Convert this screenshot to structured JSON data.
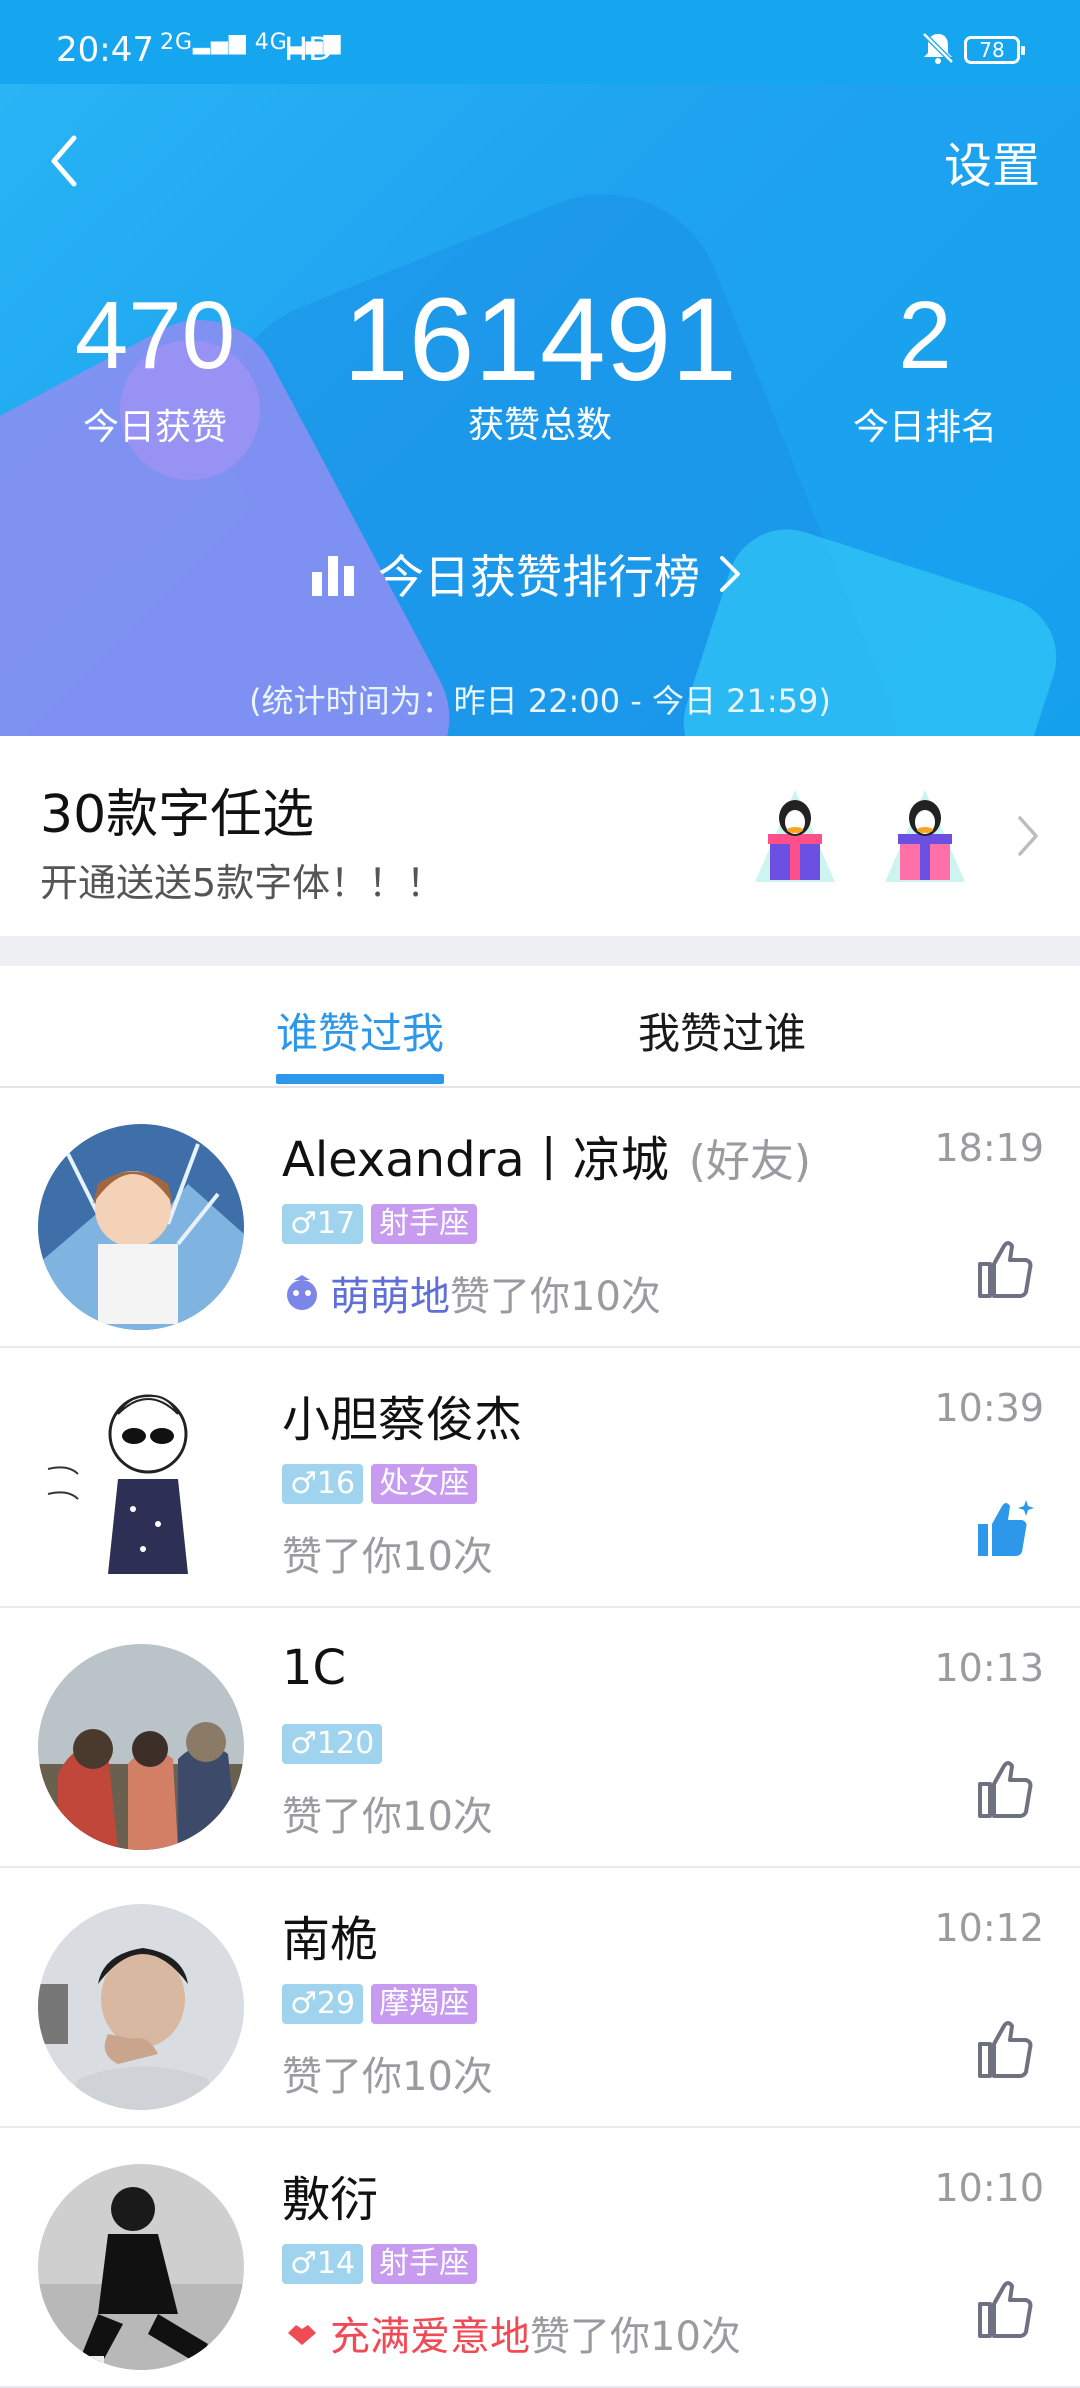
{
  "status_bar": {
    "time": "20:47",
    "signal1": "2G",
    "signal2": "4G",
    "hd": "HD",
    "battery": "78"
  },
  "header": {
    "settings_label": "设置",
    "stats": {
      "today_likes": {
        "value": "470",
        "label": "今日获赞"
      },
      "total_likes": {
        "value": "161491",
        "label": "获赞总数"
      },
      "today_rank": {
        "value": "2",
        "label": "今日排名"
      }
    },
    "ranking_link_label": "今日获赞排行榜",
    "stats_period": "(统计时间为：昨日 22:00 - 今日 21:59)"
  },
  "promo": {
    "title": "30款字任选",
    "subtitle": "开通送送5款字体！！！"
  },
  "tabs": {
    "liked_me": "谁赞过我",
    "i_liked": "我赞过谁"
  },
  "list": [
    {
      "name": "Alexandra丨凉城",
      "friend": "(好友)",
      "time": "18:19",
      "age": "♂17",
      "zodiac": "射手座",
      "prefix": "萌萌地",
      "text": "赞了你10次"
    },
    {
      "name": "小胆蔡俊杰",
      "time": "10:39",
      "age": "♂16",
      "zodiac": "处女座",
      "text": "赞了你10次"
    },
    {
      "name": "1C",
      "time": "10:13",
      "age": "♂120",
      "text": "赞了你10次"
    },
    {
      "name": "南桅",
      "time": "10:12",
      "age": "♂29",
      "zodiac": "摩羯座",
      "text": "赞了你10次"
    },
    {
      "name": "敷衍",
      "time": "10:10",
      "age": "♂14",
      "zodiac": "射手座",
      "prefix": "充满爱意地",
      "text": "赞了你10次"
    }
  ],
  "colors": {
    "header_blue": "#1fa3f0",
    "accent_blue": "#2d98ea",
    "age_tag": "#9fd3ee",
    "zodiac_tag": "#c79cf0",
    "thumb_gray": "#6e7280",
    "thumb_liked": "#2d98ea"
  },
  "icons": [
    "back-arrow",
    "mute-bell",
    "bar-chart",
    "chevron-right",
    "gift-box",
    "thumbs-up"
  ]
}
